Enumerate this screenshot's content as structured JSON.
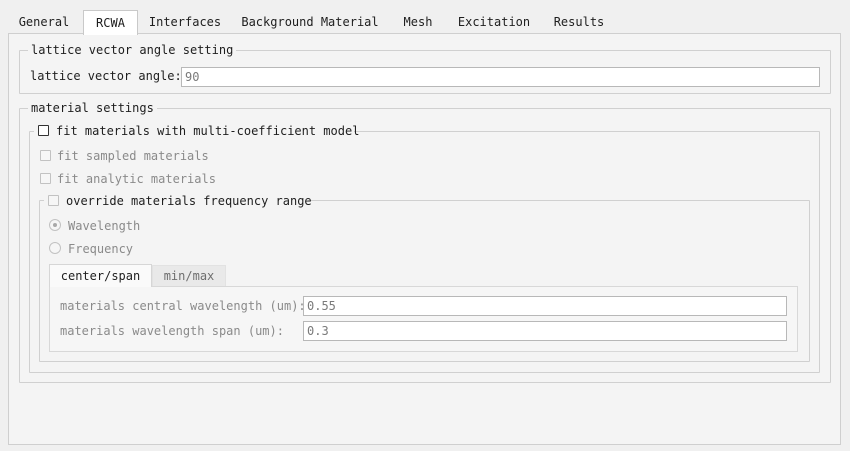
{
  "tabs": [
    "General",
    "RCWA",
    "Interfaces",
    "Background Material",
    "Mesh",
    "Excitation",
    "Results"
  ],
  "active_tab": "RCWA",
  "lattice": {
    "group_title": "lattice vector angle setting",
    "angle_label": "lattice vector angle:",
    "angle_value": "90"
  },
  "material": {
    "group_title": "material settings",
    "fit_multi_label": "fit materials with multi-coefficient model",
    "fit_multi_checked": false,
    "fit_sampled_label": "fit sampled materials",
    "fit_sampled_checked": false,
    "fit_analytic_label": "fit analytic materials",
    "fit_analytic_checked": false,
    "override_label": "override materials frequency range",
    "override_checked": false,
    "radio_wavelength": "Wavelength",
    "radio_frequency": "Frequency",
    "selected_radio": "Wavelength",
    "subtabs": [
      "center/span",
      "min/max"
    ],
    "active_subtab": "center/span",
    "central_wavelength_label": "materials central wavelength (um):",
    "central_wavelength_value": "0.55",
    "wavelength_span_label": "materials wavelength span (um):",
    "wavelength_span_value": "0.3"
  }
}
